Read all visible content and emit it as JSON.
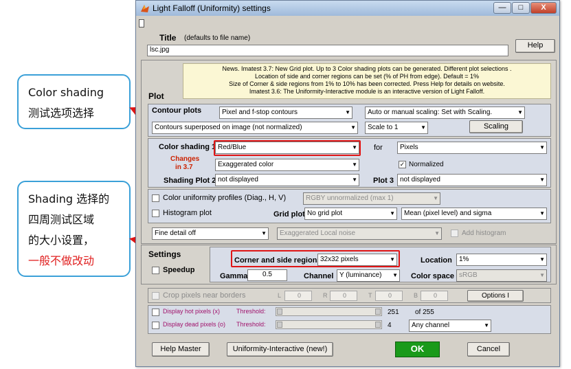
{
  "window": {
    "title": "Light Falloff (Uniformity) settings",
    "controls": {
      "minimize": "—",
      "maximize": "□",
      "close": "X"
    }
  },
  "title_section": {
    "label": "Title",
    "hint": "(defaults to file name)",
    "value": "lsc.jpg",
    "help_label": "Help"
  },
  "news": {
    "line1": "News. Imatest 3.7:  New Grid plot.  Up to 3 Color shading plots can be generated.  Different plot selections .",
    "line2": "Location of side and corner regions can be set (% of PH from edge). Default = 1%",
    "line3": "Size of Corner & side regions from 1% to 10% has been corrected. Press Help for details on website.",
    "line4": "Imatest 3.6: The Uniformity-Interactive module is an interactive version of Light Falloff."
  },
  "plot": {
    "section_label": "Plot",
    "contour_label": "Contour plots",
    "contour_value": "Pixel and f-stop contours",
    "scaling_mode": "Auto or manual scaling: Set with Scaling.",
    "contour_overlay": "Contours superposed on image (not normalized)",
    "scale_value": "Scale to 1",
    "scaling_button": "Scaling",
    "color_shading_label": "Color shading 1",
    "color_shading_value": "Red/Blue",
    "for_label": "for",
    "for_value": "Pixels",
    "changes_label": "Changes",
    "changes_version": "in 3.7",
    "exaggerated_value": "Exaggerated color",
    "normalized_label": "Normalized",
    "shading2_label": "Shading Plot 2",
    "shading2_value": "not displayed",
    "plot3_label": "Plot 3",
    "plot3_value": "not displayed",
    "uniformity_label": "Color uniformity profiles (Diag., H, V)",
    "uniformity_value": "RGBY unnormalized (max 1)",
    "histogram_label": "Histogram plot",
    "grid_plot_label": "Grid plot",
    "grid_plot_value": "No  grid plot",
    "mean_value": "Mean (pixel level) and sigma",
    "fine_detail_value": "Fine detail off",
    "local_noise_value": "Exaggerated Local noise",
    "add_histogram_label": "Add histogram"
  },
  "settings": {
    "section_label": "Settings",
    "speedup_label": "Speedup",
    "corner_label": "Corner and side regions",
    "corner_value": "32x32 pixels",
    "location_label": "Location",
    "location_value": "1%",
    "gamma_label": "Gamma",
    "gamma_value": "0.5",
    "channel_label": "Channel",
    "channel_value": "Y (luminance)",
    "color_space_label": "Color space",
    "color_space_value": "sRGB"
  },
  "crop": {
    "label": "Crop pixels near borders",
    "L_label": "L",
    "L_value": "0",
    "R_label": "R",
    "R_value": "0",
    "T_label": "T",
    "T_value": "0",
    "B_label": "B",
    "B_value": "0",
    "options_label": "Options I"
  },
  "pixels": {
    "hot_label": "Display hot pixels (x)",
    "hot_threshold": "Threshold:",
    "hot_value": "251",
    "hot_of": "of 255",
    "dead_label": "Display dead pixels (o)",
    "dead_threshold": "Threshold:",
    "dead_value": "4",
    "any_channel": "Any channel"
  },
  "footer": {
    "help_master": "Help Master",
    "interactive": "Uniformity-Interactive (new!)",
    "ok": "OK",
    "cancel": "Cancel"
  },
  "annotations": {
    "callout1_line1": "Color shading",
    "callout1_line2": "测试选项选择",
    "callout2_line1": "Shading 选择的",
    "callout2_line2": "四周测试区域",
    "callout2_line3": "的大小设置，",
    "callout2_line4": "一般不做改动"
  },
  "colors": {
    "annotation_border": "#3aa0d8",
    "highlight_red": "#e01515",
    "ok_green": "#1a9a1a",
    "changes_red": "#cc2200",
    "hot_dead_label": "#a0106a"
  }
}
